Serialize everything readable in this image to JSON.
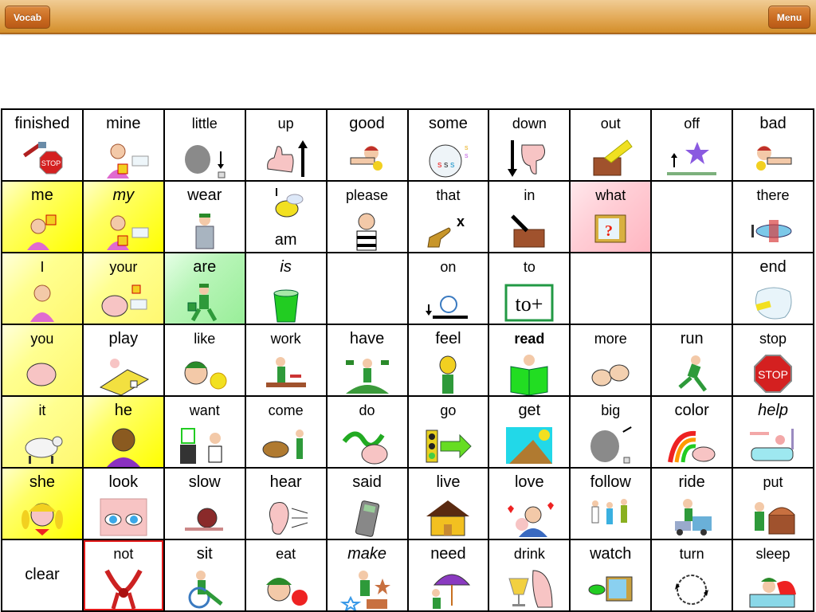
{
  "toolbar": {
    "left_button": "Vocab",
    "right_button": "Menu"
  },
  "message_area": {
    "text": ""
  },
  "colors": {
    "toolbar": "#e3aa58",
    "button": "#c8681f",
    "pronoun_yellow": "#ffff00",
    "pronoun_light_yellow": "#fff870",
    "verb_green": "#99ee99",
    "question_pink": "#ffb6c1",
    "selection_outline": "#e21a1a"
  },
  "grid": {
    "rows": [
      [
        {
          "label": "finished",
          "icon": "stop-hammer-icon",
          "style": ""
        },
        {
          "label": "mine",
          "icon": "girl-gift-tag-icon",
          "style": ""
        },
        {
          "label": "little",
          "icon": "little-elephant-icon",
          "style": "small"
        },
        {
          "label": "up",
          "icon": "thumb-up-arrow-icon",
          "style": "small"
        },
        {
          "label": "good",
          "icon": "boy-thumbs-up-icon",
          "style": ""
        },
        {
          "label": "some",
          "icon": "some-circle-icon",
          "style": ""
        },
        {
          "label": "down",
          "icon": "thumb-down-arrow-icon",
          "style": "small"
        },
        {
          "label": "out",
          "icon": "box-exit-icon",
          "style": "small"
        },
        {
          "label": "off",
          "icon": "balloon-star-icon",
          "style": "small"
        },
        {
          "label": "bad",
          "icon": "boy-thumbs-down-icon",
          "style": ""
        }
      ],
      [
        {
          "label": "me",
          "icon": "girl-holding-gift-icon",
          "color": "yellow"
        },
        {
          "label": "my",
          "icon": "girl-gift-tag-icon",
          "color": "yellow",
          "style": "italic"
        },
        {
          "label": "wear",
          "icon": "man-suit-icon",
          "style": ""
        },
        {
          "label": "am",
          "icon": "bee-icon",
          "style": "",
          "layout": "am"
        },
        {
          "label": "please",
          "icon": "prisoner-please-icon",
          "style": "small"
        },
        {
          "label": "that",
          "icon": "pointing-hand-x-icon",
          "style": "small"
        },
        {
          "label": "in",
          "icon": "arrow-into-box-icon",
          "style": "small"
        },
        {
          "label": "what",
          "icon": "tv-question-icon",
          "color": "pink",
          "style": "small"
        },
        {
          "label": "",
          "icon": "",
          "style": ""
        },
        {
          "label": "there",
          "icon": "airplane-icon",
          "style": "small"
        }
      ],
      [
        {
          "label": "I",
          "icon": "girl-self-icon",
          "color": "yellow-light",
          "style": "small"
        },
        {
          "label": "your",
          "icon": "pointing-fist-gift-icon",
          "color": "yellow-light",
          "style": "small"
        },
        {
          "label": "are",
          "icon": "worker-walking-icon",
          "color": "green",
          "style": ""
        },
        {
          "label": "is",
          "icon": "green-bucket-icon",
          "style": "italic"
        },
        {
          "label": "",
          "icon": "",
          "style": ""
        },
        {
          "label": "on",
          "icon": "wheelchair-on-icon",
          "style": "small"
        },
        {
          "label": "to",
          "icon": "to-plus-icon",
          "style": "small"
        },
        {
          "label": "",
          "icon": "",
          "style": ""
        },
        {
          "label": "",
          "icon": "",
          "style": ""
        },
        {
          "label": "end",
          "icon": "map-end-icon",
          "style": ""
        }
      ],
      [
        {
          "label": "you",
          "icon": "pointing-fist-icon",
          "color": "yellow-light",
          "style": "small"
        },
        {
          "label": "play",
          "icon": "board-game-icon",
          "style": ""
        },
        {
          "label": "like",
          "icon": "worker-sun-icon",
          "style": "small"
        },
        {
          "label": "work",
          "icon": "worker-hammer-icon",
          "style": "small"
        },
        {
          "label": "have",
          "icon": "worker-money-icon",
          "style": ""
        },
        {
          "label": "feel",
          "icon": "worker-mask-icon",
          "style": ""
        },
        {
          "label": "read",
          "icon": "reading-book-icon",
          "style": "bold"
        },
        {
          "label": "more",
          "icon": "more-sign-icon",
          "style": "small"
        },
        {
          "label": "run",
          "icon": "worker-running-icon",
          "style": ""
        },
        {
          "label": "stop",
          "icon": "stop-sign-icon",
          "style": "small"
        }
      ],
      [
        {
          "label": "it",
          "icon": "sheep-toy-icon",
          "color": "yellow-light",
          "style": "small"
        },
        {
          "label": "he",
          "icon": "boy-face-icon",
          "color": "yellow",
          "style": ""
        },
        {
          "label": "want",
          "icon": "want-picture-icon",
          "style": "small"
        },
        {
          "label": "come",
          "icon": "dog-come-icon",
          "style": "small"
        },
        {
          "label": "do",
          "icon": "hand-scribble-icon",
          "style": "small"
        },
        {
          "label": "go",
          "icon": "traffic-light-arrow-icon",
          "style": "small"
        },
        {
          "label": "get",
          "icon": "mountain-climb-icon",
          "style": ""
        },
        {
          "label": "big",
          "icon": "big-elephant-icon",
          "style": "small"
        },
        {
          "label": "color",
          "icon": "rainbow-marker-icon",
          "style": ""
        },
        {
          "label": "help",
          "icon": "bathtub-help-icon",
          "style": "italic"
        }
      ],
      [
        {
          "label": "she",
          "icon": "girl-pigtails-icon",
          "color": "yellow",
          "style": ""
        },
        {
          "label": "look",
          "icon": "eyes-icon",
          "style": ""
        },
        {
          "label": "slow",
          "icon": "snail-icon",
          "style": ""
        },
        {
          "label": "hear",
          "icon": "ear-icon",
          "style": ""
        },
        {
          "label": "said",
          "icon": "cell-phone-icon",
          "style": ""
        },
        {
          "label": "live",
          "icon": "house-icon",
          "style": ""
        },
        {
          "label": "love",
          "icon": "mother-baby-hearts-icon",
          "style": ""
        },
        {
          "label": "follow",
          "icon": "people-walking-icon",
          "style": ""
        },
        {
          "label": "ride",
          "icon": "worker-truck-icon",
          "style": ""
        },
        {
          "label": "put",
          "icon": "worker-chest-icon",
          "style": "small"
        }
      ],
      [
        {
          "label": "clear",
          "icon": "",
          "style": "",
          "layout": "center"
        },
        {
          "label": "not",
          "icon": "knot-rope-icon",
          "style": "small",
          "outlined": true
        },
        {
          "label": "sit",
          "icon": "wheelchair-sit-icon",
          "style": ""
        },
        {
          "label": "eat",
          "icon": "worker-apple-icon",
          "style": "small"
        },
        {
          "label": "make",
          "icon": "worker-stars-icon",
          "style": "italic"
        },
        {
          "label": "need",
          "icon": "umbrella-rain-icon",
          "style": ""
        },
        {
          "label": "drink",
          "icon": "glass-straw-icon",
          "style": "small"
        },
        {
          "label": "watch",
          "icon": "eye-tv-icon",
          "style": ""
        },
        {
          "label": "turn",
          "icon": "circle-arrows-icon",
          "style": "small"
        },
        {
          "label": "sleep",
          "icon": "worker-bed-icon",
          "style": "small"
        }
      ]
    ]
  }
}
